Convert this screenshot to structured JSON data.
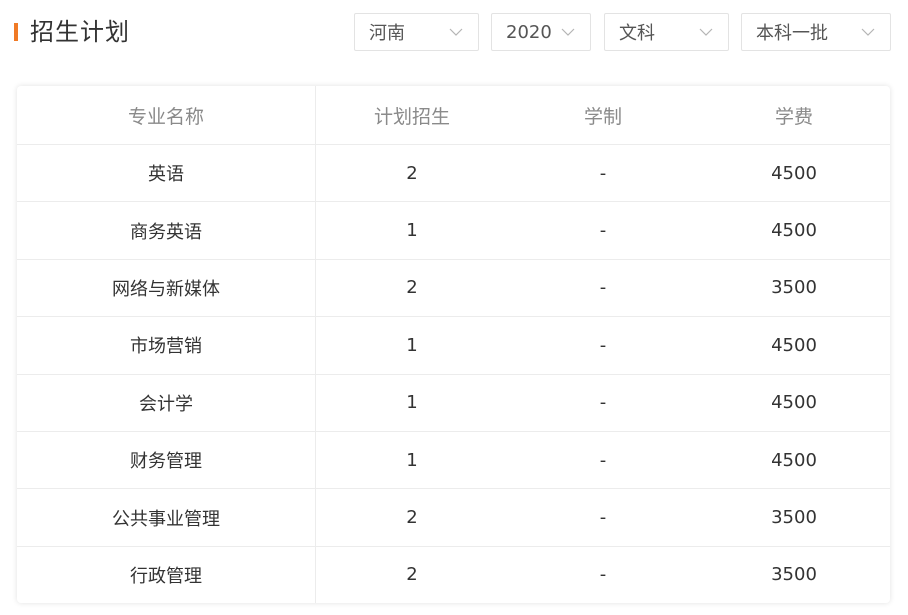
{
  "header": {
    "title": "招生计划"
  },
  "filters": [
    {
      "name": "province-select",
      "value": "河南"
    },
    {
      "name": "year-select",
      "value": "2020"
    },
    {
      "name": "subject-select",
      "value": "文科"
    },
    {
      "name": "batch-select",
      "value": "本科一批"
    }
  ],
  "table": {
    "columns": [
      "专业名称",
      "计划招生",
      "学制",
      "学费"
    ],
    "rows": [
      {
        "major": "英语",
        "plan": "2",
        "duration": "-",
        "fee": "4500"
      },
      {
        "major": "商务英语",
        "plan": "1",
        "duration": "-",
        "fee": "4500"
      },
      {
        "major": "网络与新媒体",
        "plan": "2",
        "duration": "-",
        "fee": "3500"
      },
      {
        "major": "市场营销",
        "plan": "1",
        "duration": "-",
        "fee": "4500"
      },
      {
        "major": "会计学",
        "plan": "1",
        "duration": "-",
        "fee": "4500"
      },
      {
        "major": "财务管理",
        "plan": "1",
        "duration": "-",
        "fee": "4500"
      },
      {
        "major": "公共事业管理",
        "plan": "2",
        "duration": "-",
        "fee": "3500"
      },
      {
        "major": "行政管理",
        "plan": "2",
        "duration": "-",
        "fee": "3500"
      }
    ]
  },
  "colors": {
    "accent": "#f07a26",
    "text": "#333333",
    "header_text": "#8a8a8a",
    "border": "#ececec"
  },
  "icons": {
    "dropdown": "chevron-down-icon"
  }
}
